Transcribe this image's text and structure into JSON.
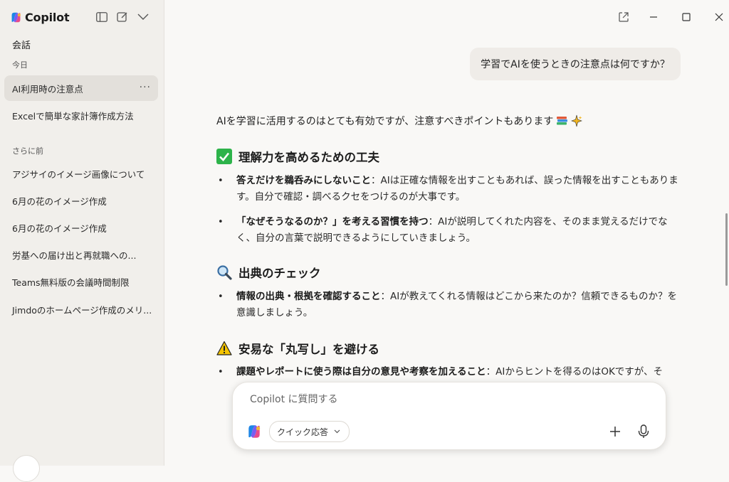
{
  "sidebar": {
    "app_name": "Copilot",
    "section_title": "会話",
    "groups": [
      {
        "label": "今日",
        "items": [
          "AI利用時の注意点",
          "Excelで簡単な家計簿作成方法"
        ]
      },
      {
        "label": "さらに前",
        "items": [
          "アジサイのイメージ画像について",
          "6月の花のイメージ作成",
          "6月の花のイメージ作成",
          "労基への届け出と再就職への...",
          "Teams無料版の会議時間制限",
          "Jimdoのホームページ作成のメリ..."
        ]
      }
    ],
    "more_label": "···"
  },
  "chat": {
    "user_message": "学習でAIを使うときの注意点は何ですか？",
    "intro": "AIを学習に活用するのはとても有効ですが、注意すべきポイントもあります",
    "sections": [
      {
        "icon": "check-mark-icon",
        "title": "理解力を高めるための工夫",
        "bullets": [
          {
            "bold": "答えだけを鵜呑みにしないこと",
            "rest": "：AIは正確な情報を出すこともあれば、誤った情報を出すこともあります。自分で確認・調べるクセをつけるのが大事です。"
          },
          {
            "bold": "「なぜそうなるのか？」を考える習慣を持つ",
            "rest": "：AIが説明してくれた内容を、そのまま覚えるだけでなく、自分の言葉で説明できるようにしていきましょう。"
          }
        ]
      },
      {
        "icon": "magnifier-icon",
        "title": "出典のチェック",
        "bullets": [
          {
            "bold": "情報の出典・根拠を確認すること",
            "rest": "：AIが教えてくれる情報はどこから来たのか？信頼できるものか？を意識しましょう。"
          }
        ]
      },
      {
        "icon": "warning-icon",
        "title": "安易な「丸写し」を避ける",
        "bullets": [
          {
            "bold": "課題やレポートに使う際は自分の意見や考察を加えること",
            "rest": "：AIからヒントを得るのはOKですが、そ"
          }
        ]
      }
    ]
  },
  "composer": {
    "placeholder": "Copilot に質問する",
    "mode_label": "クイック応答"
  },
  "colors": {
    "sidebar_bg": "#f1efeb",
    "main_bg": "#f9f8f6",
    "check_green": "#2db34a",
    "warning_yellow": "#f5c400"
  }
}
